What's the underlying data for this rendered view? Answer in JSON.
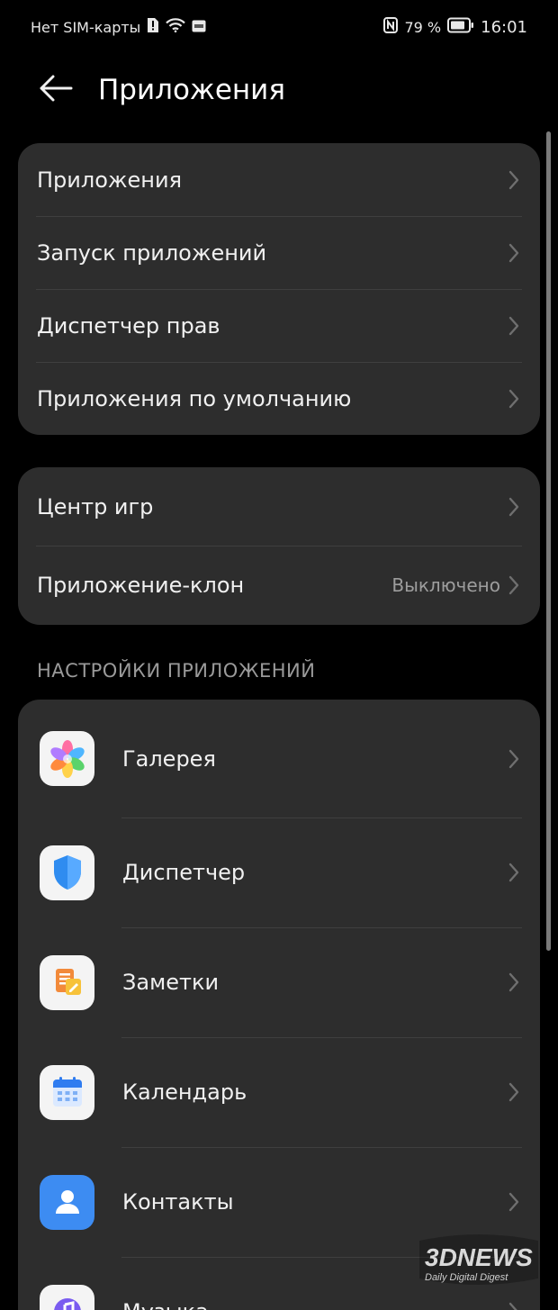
{
  "status_bar": {
    "carrier": "Нет SIM-карты",
    "battery_percent": "79 %",
    "time": "16:01"
  },
  "header": {
    "title": "Приложения"
  },
  "group1": {
    "items": [
      {
        "label": "Приложения"
      },
      {
        "label": "Запуск приложений"
      },
      {
        "label": "Диспетчер прав"
      },
      {
        "label": "Приложения по умолчанию"
      }
    ]
  },
  "group2": {
    "items": [
      {
        "label": "Центр игр",
        "value": ""
      },
      {
        "label": "Приложение-клон",
        "value": "Выключено"
      }
    ]
  },
  "app_settings": {
    "header": "НАСТРОЙКИ ПРИЛОЖЕНИЙ",
    "apps": [
      {
        "label": "Галерея",
        "icon": "gallery-icon"
      },
      {
        "label": "Диспетчер",
        "icon": "shield-icon"
      },
      {
        "label": "Заметки",
        "icon": "notes-icon"
      },
      {
        "label": "Календарь",
        "icon": "calendar-icon"
      },
      {
        "label": "Контакты",
        "icon": "contacts-icon"
      },
      {
        "label": "Музыка",
        "icon": "music-icon"
      }
    ]
  },
  "watermark": {
    "brand": "3DNEWS",
    "tagline": "Daily Digital Digest"
  },
  "colors": {
    "background": "#000000",
    "card": "#2d2d2d",
    "text": "#f0f0f0",
    "secondary_text": "#9d9d9d"
  }
}
